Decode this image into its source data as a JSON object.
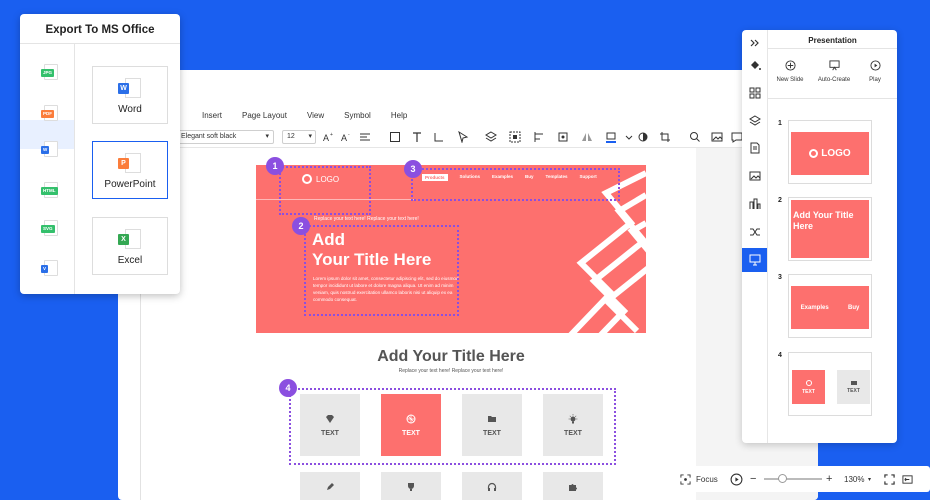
{
  "export_panel": {
    "title": "Export To MS Office",
    "file_types": [
      {
        "tag": "JPG",
        "color": "#34c06c"
      },
      {
        "tag": "PDF",
        "color": "#fb7d3b"
      },
      {
        "tag": "W",
        "color": "#2b6fe8"
      },
      {
        "tag": "HTML",
        "color": "#34c06c"
      },
      {
        "tag": "SVG",
        "color": "#34c06c"
      },
      {
        "tag": "V",
        "color": "#2b6fe8"
      }
    ],
    "options": [
      {
        "label": "Word",
        "letter": "W",
        "color": "#2b6fe8"
      },
      {
        "label": "PowerPoint",
        "letter": "P",
        "color": "#fb7d3b"
      },
      {
        "label": "Excel",
        "letter": "X",
        "color": "#34a853"
      }
    ]
  },
  "menu": [
    "Insert",
    "Page Layout",
    "View",
    "Symbol",
    "Help"
  ],
  "toolbar": {
    "font": "Elegant soft black",
    "size": "12"
  },
  "slide": {
    "logo": "LOGO",
    "nav": [
      "Products",
      "Solutions",
      "Examples",
      "Buy",
      "Templates",
      "Support"
    ],
    "subtitle": "Replace your text here!  Replace your text here!",
    "title_line1": "Add",
    "title_line2": "Your Title Here",
    "body": "Lorem ipsum dolor sit amet, consectetur adipiscing elit, sed do eiusmod tempor incididunt ut labore et dolore magna aliqua. Ut enim ad minim veniam, quis nostrud exercitation ullamco laboris nisi ut aliquip ex ea commodo consequat.",
    "section_title": "Add Your Title Here",
    "section_sub": "Replace your text here!   Replace your text here!",
    "cards": [
      "TEXT",
      "TEXT",
      "TEXT",
      "TEXT"
    ]
  },
  "callouts": [
    "1",
    "2",
    "3",
    "4"
  ],
  "panel": {
    "title": "Presentation",
    "buttons": [
      "New Slide",
      "Auto-Create",
      "Play"
    ],
    "thumbs": [
      {
        "num": "1",
        "logo": "LOGO"
      },
      {
        "num": "2",
        "title": "Add Your Title Here"
      },
      {
        "num": "3",
        "left": "Examples",
        "right": "Buy"
      },
      {
        "num": "4",
        "left": "TEXT",
        "right": "TEXT"
      }
    ]
  },
  "zoom": {
    "focus": "Focus",
    "level": "130%"
  },
  "colors": {
    "brand": "#1a5ff0",
    "slide": "#fd706e",
    "callout": "#8b4fe0"
  }
}
